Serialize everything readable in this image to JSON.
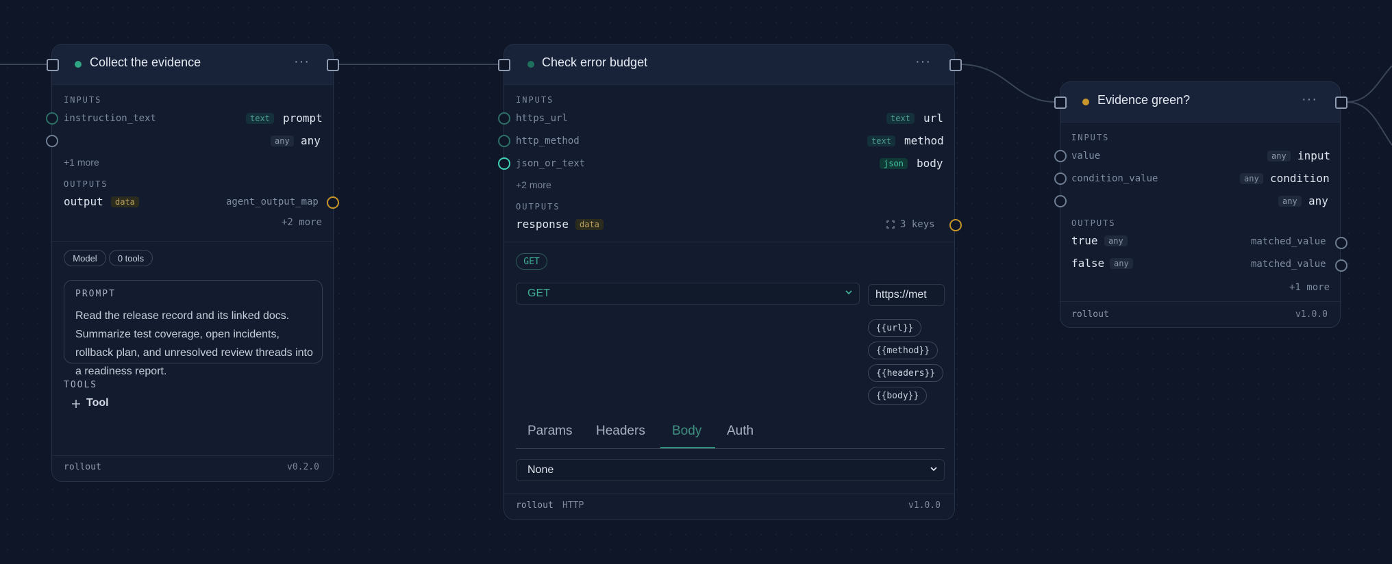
{
  "nodes": [
    {
      "title": "Collect the evidence",
      "status_color": "#2fa583",
      "menu": "···",
      "inputs_label": "INPUTS",
      "inputs": [
        {
          "left": "instruction_text",
          "type": "text",
          "right": "prompt"
        },
        {
          "left": "",
          "type": "any",
          "right": "any"
        }
      ],
      "inputs_more": "+1 more",
      "outputs_label": "OUTPUTS",
      "output": {
        "name": "output",
        "type": "data",
        "right": "agent_output_map"
      },
      "outputs_more": "+2 more",
      "pills": [
        "Model",
        "0 tools"
      ],
      "prompt_label": "PROMPT",
      "prompt_text": "Read the release record and its linked docs. Summarize test coverage, open incidents, rollback plan, and unresolved review threads into a readiness report.",
      "tools_label": "TOOLS",
      "tool_add_icon": "plus-icon",
      "tool_add": "Tool",
      "footer_left": "rollout",
      "footer_version": "v0.2.0"
    },
    {
      "title": "Check error budget",
      "status_color": "#1f6f5d",
      "menu": "···",
      "inputs_label": "INPUTS",
      "inputs": [
        {
          "left": "https_url",
          "type": "text",
          "right": "url"
        },
        {
          "left": "http_method",
          "type": "text",
          "right": "method"
        },
        {
          "left": "json_or_text",
          "type": "json",
          "right": "body"
        }
      ],
      "inputs_more": "+2 more",
      "outputs_label": "OUTPUTS",
      "output": {
        "name": "response",
        "type": "data",
        "right": "3 keys"
      },
      "expand_icon": "expand-icon",
      "method_pill": "GET",
      "method_select": "GET",
      "url_value": "https://met",
      "vars": [
        "{{url}}",
        "{{method}}",
        "{{headers}}",
        "{{body}}"
      ],
      "tabs": [
        "Params",
        "Headers",
        "Body",
        "Auth"
      ],
      "active_tab": "Body",
      "body_select": "None",
      "footer_left": "rollout",
      "footer_tag": "HTTP",
      "footer_version": "v1.0.0"
    },
    {
      "title": "Evidence green?",
      "status_color": "#c9962a",
      "menu": "···",
      "inputs_label": "INPUTS",
      "inputs": [
        {
          "left": "value",
          "type": "any",
          "right": "input"
        },
        {
          "left": "condition_value",
          "type": "any",
          "right": "condition"
        },
        {
          "left": "",
          "type": "any",
          "right": "any"
        }
      ],
      "outputs_label": "OUTPUTS",
      "outputs": [
        {
          "name": "true",
          "type": "any",
          "right": "matched_value"
        },
        {
          "name": "false",
          "type": "any",
          "right": "matched_value"
        }
      ],
      "outputs_more": "+1 more",
      "footer_left": "rollout",
      "footer_version": "v1.0.0"
    }
  ]
}
